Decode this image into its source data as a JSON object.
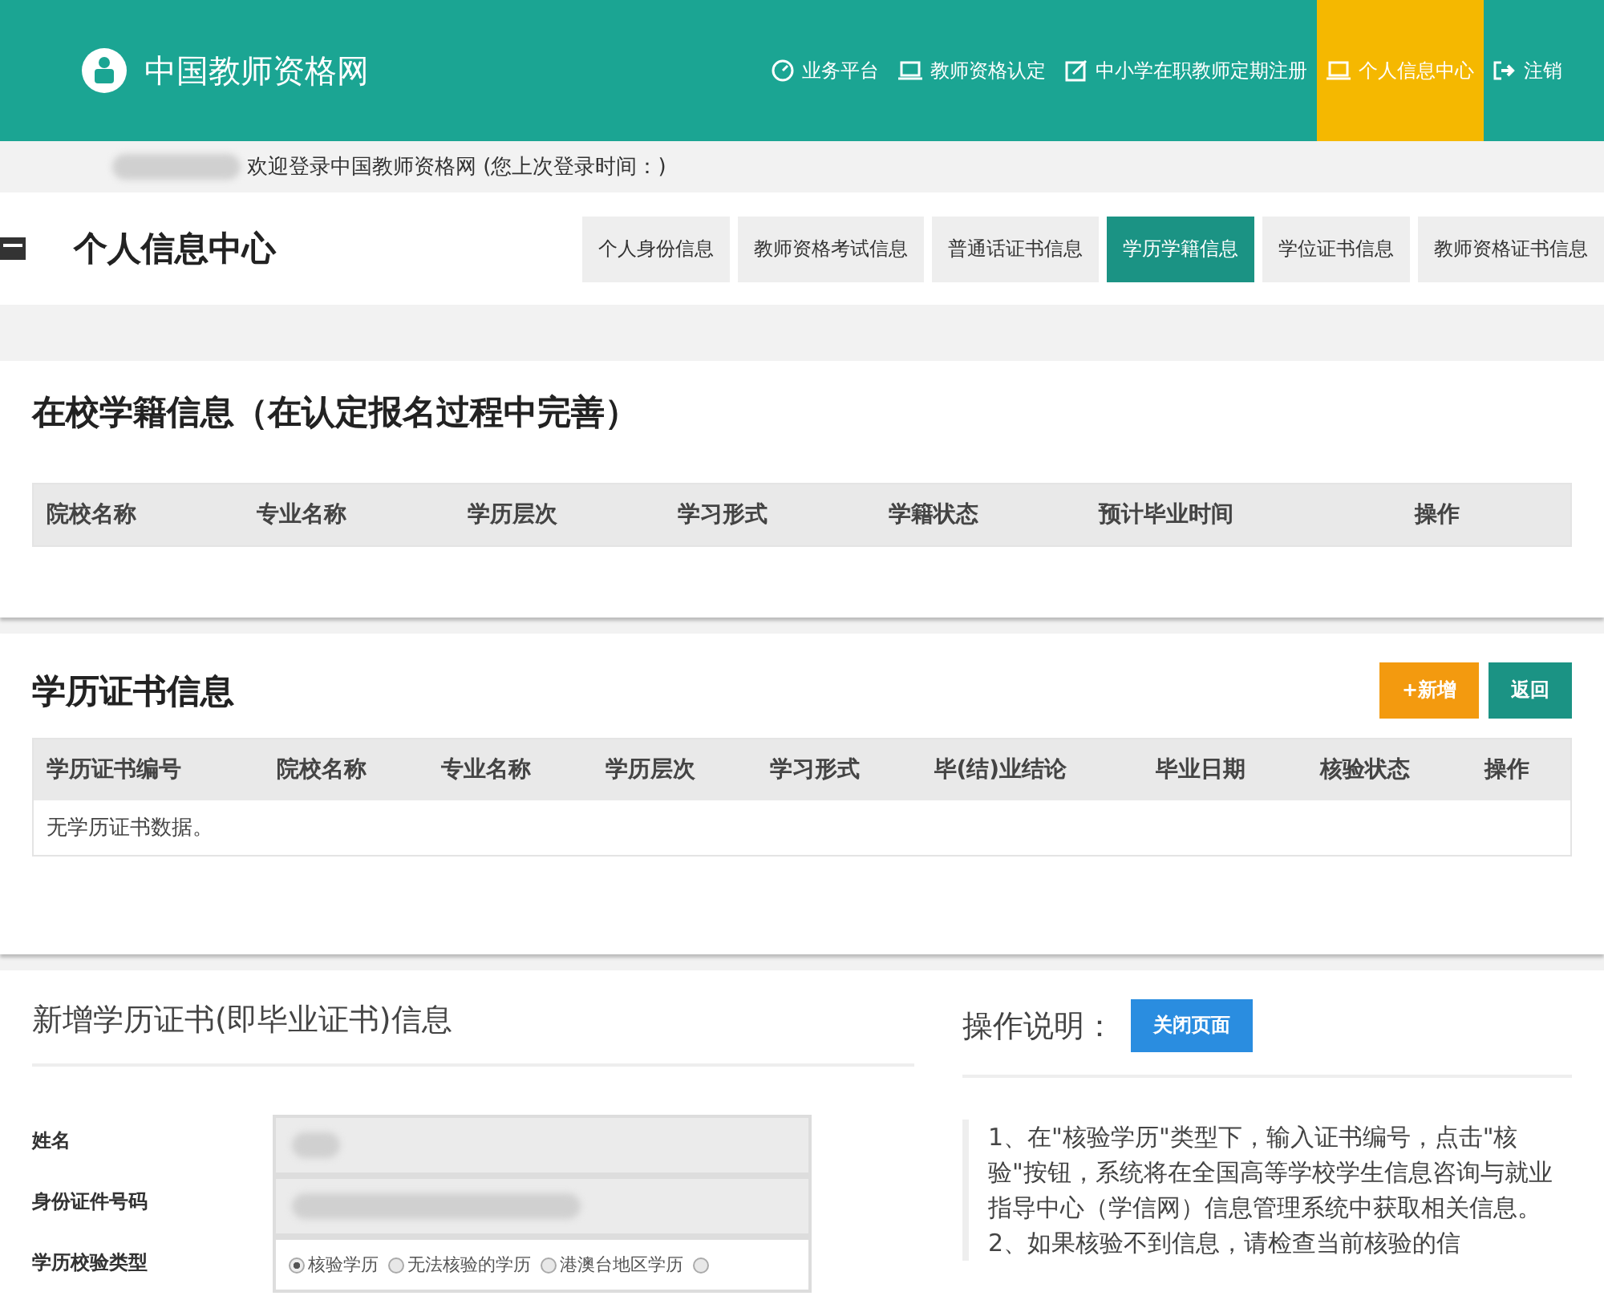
{
  "header": {
    "site_title": "中国教师资格网",
    "nav": [
      {
        "label": "业务平台",
        "kind": "platform",
        "selected": false
      },
      {
        "label": "教师资格认定",
        "kind": "section",
        "selected": false
      },
      {
        "label": "中小学在职教师定期注册",
        "kind": "register",
        "selected": false
      },
      {
        "label": "个人信息中心",
        "kind": "section",
        "selected": true
      },
      {
        "label": "注销",
        "kind": "logout",
        "selected": false
      }
    ]
  },
  "welcome": "欢迎登录中国教师资格网 (您上次登录时间：)",
  "page_title": "个人信息中心",
  "tabs": [
    {
      "label": "个人身份信息",
      "selected": false
    },
    {
      "label": "教师资格考试信息",
      "selected": false
    },
    {
      "label": "普通话证书信息",
      "selected": false
    },
    {
      "label": "学历学籍信息",
      "selected": true
    },
    {
      "label": "学位证书信息",
      "selected": false
    },
    {
      "label": "教师资格证书信息",
      "selected": false
    }
  ],
  "school_section": {
    "title": "在校学籍信息（在认定报名过程中完善）",
    "columns": [
      "院校名称",
      "专业名称",
      "学历层次",
      "学习形式",
      "学籍状态",
      "预计毕业时间",
      "操作"
    ]
  },
  "cert_section": {
    "title": "学历证书信息",
    "buttons": [
      {
        "label": "+新增",
        "kind": "add"
      },
      {
        "label": "返回",
        "kind": "back"
      }
    ],
    "columns": [
      "学历证书编号",
      "院校名称",
      "专业名称",
      "学历层次",
      "学习形式",
      "毕(结)业结论",
      "毕业日期",
      "核验状态",
      "操作"
    ],
    "empty_message": "无学历证书数据。"
  },
  "form": {
    "title": "新增学历证书(即毕业证书)信息",
    "fields": [
      {
        "label": "姓名",
        "kind": "blurred"
      },
      {
        "label": "身份证件号码",
        "kind": "blurred"
      },
      {
        "label": "学历校验类型",
        "kind": "radio",
        "options": [
          {
            "label": "核验学历",
            "selected": true
          },
          {
            "label": "无法核验的学历",
            "selected": false
          },
          {
            "label": "港澳台地区学历",
            "selected": false
          },
          {
            "selected": false
          }
        ]
      }
    ]
  },
  "help": {
    "title": "操作说明：",
    "close_button": "关闭页面",
    "paragraphs": [
      "1、在\"核验学历\"类型下，输入证书编号，点击\"核验\"按钮，系统将在全国高等学校学生信息咨询与就业指导中心（学信网）信息管理系统中获取相关信息。",
      "2、如果核验不到信息，请检查当前核验的信"
    ]
  }
}
